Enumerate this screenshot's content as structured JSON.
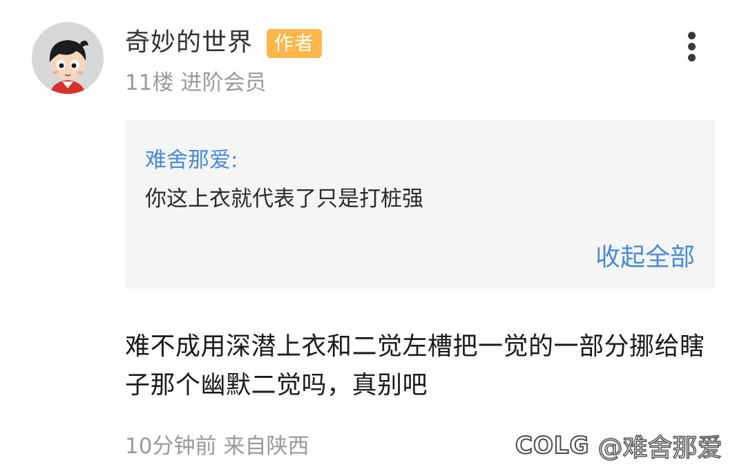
{
  "post": {
    "username": "奇妙的世界",
    "author_badge": "作者",
    "floor": "11楼",
    "member_level": "进阶会员",
    "quote": {
      "user": "难舍那爱:",
      "text": "你这上衣就代表了只是打桩强",
      "collapse_label": "收起全部"
    },
    "body": "难不成用深潜上衣和二觉左槽把一觉的一部分挪给瞎子那个幽默二觉吗，真别吧",
    "time": "10分钟前",
    "location": "来自陕西"
  },
  "watermark": {
    "logo": "COLG",
    "handle": "@难舍那爱"
  },
  "icons": {
    "avatar": "cartoon-boy-avatar",
    "menu": "more-vertical-icon"
  },
  "colors": {
    "author_badge": "#ffb74a",
    "link_blue": "#4a8ad8",
    "quote_bg": "#f5f5f5",
    "meta_gray": "#9a9a9a"
  }
}
